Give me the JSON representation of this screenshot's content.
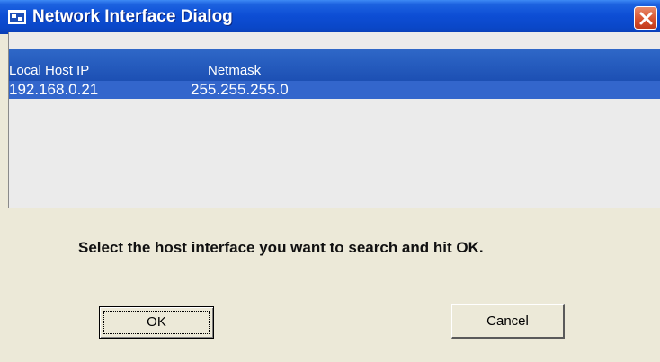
{
  "window": {
    "title": "Network Interface Dialog",
    "icon": "network-dialog-icon",
    "close_icon": "close-icon"
  },
  "list": {
    "columns": [
      "Local Host IP",
      "Netmask"
    ],
    "rows": [
      {
        "ip": "192.168.0.21",
        "netmask": "255.255.255.0",
        "selected": true
      }
    ]
  },
  "prompt": "Select the host interface you want to search and hit OK.",
  "buttons": {
    "ok": "OK",
    "cancel": "Cancel"
  },
  "colors": {
    "titlebar": "#0a47c8",
    "selection": "#3366cc",
    "dialog_bg": "#ece9d8",
    "close_button": "#d9532f"
  }
}
